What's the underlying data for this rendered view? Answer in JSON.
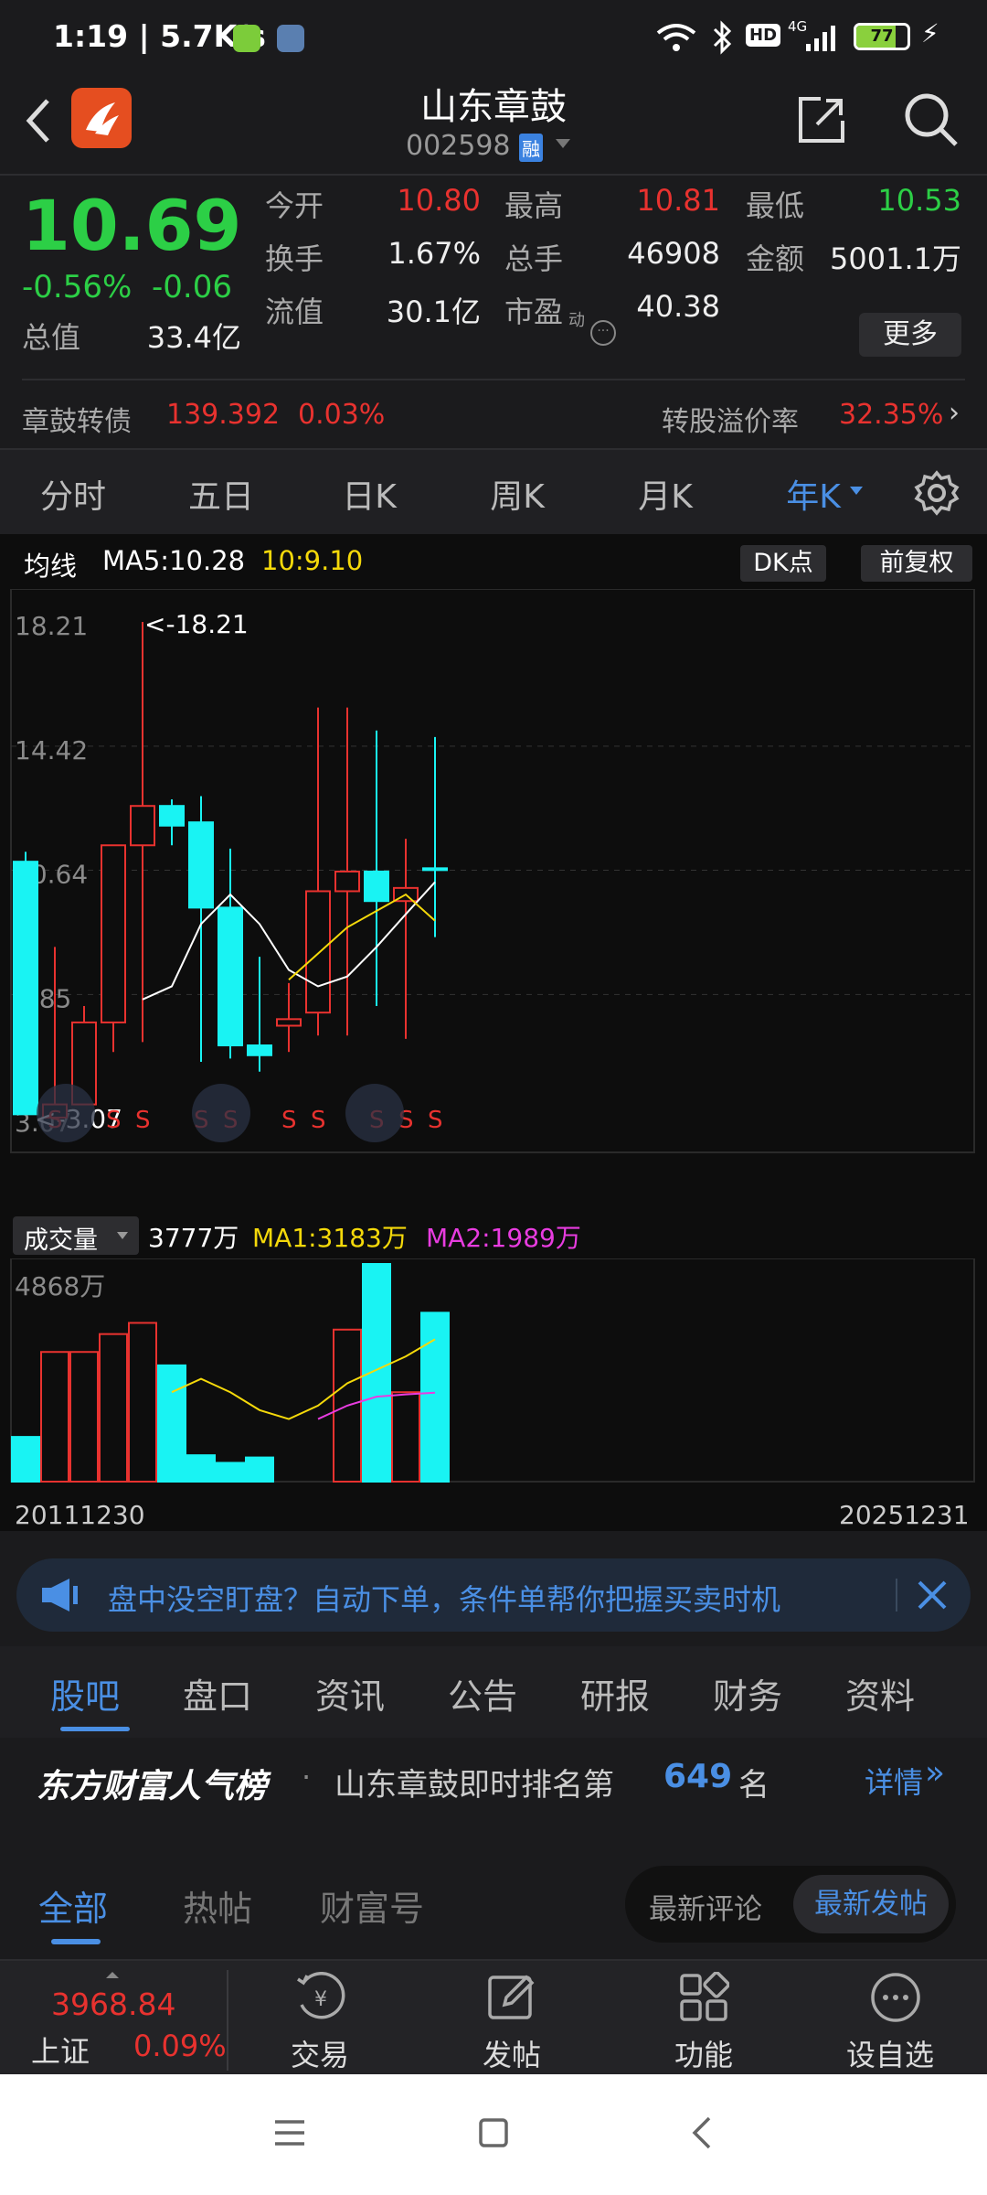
{
  "status_bar": {
    "time": "1:19 | 5.7K/s",
    "battery": "77",
    "net": "4G",
    "hd": "HD"
  },
  "header": {
    "title": "山东章鼓",
    "code": "002598",
    "rong": "融"
  },
  "quote": {
    "price": "10.69",
    "pct": "-0.56%",
    "change": "-0.06",
    "fields": [
      {
        "label": "今开",
        "value": "10.80",
        "color": "#e8322f"
      },
      {
        "label": "最高",
        "value": "10.81",
        "color": "#e8322f"
      },
      {
        "label": "最低",
        "value": "10.53",
        "color": "#2ccf46"
      },
      {
        "label": "换手",
        "value": "1.67%",
        "color": "#eeeeee"
      },
      {
        "label": "总手",
        "value": "46908",
        "color": "#eeeeee"
      },
      {
        "label": "金额",
        "value": "5001.1万",
        "color": "#eeeeee"
      },
      {
        "label": "总值",
        "value": "33.4亿",
        "color": "#eeeeee"
      },
      {
        "label": "流值",
        "value": "30.1亿",
        "color": "#eeeeee"
      },
      {
        "label": "市盈",
        "value": "40.38",
        "color": "#eeeeee"
      }
    ],
    "pe_sup": "动",
    "more": "更多"
  },
  "bond": {
    "name": "章鼓转债",
    "price": "139.392",
    "pct": "0.03%",
    "premium_label": "转股溢价率",
    "premium": "32.35%"
  },
  "chart_tabs": [
    "分时",
    "五日",
    "日K",
    "周K",
    "月K",
    "年K"
  ],
  "kline": {
    "ma_label": "均线",
    "ma5": "MA5:10.28",
    "ma10": "10:9.10",
    "dk": "DK点",
    "adjust": "前复权",
    "axis": [
      "18.21",
      "14.42",
      "10.64",
      "6.85",
      "3.07"
    ],
    "high_label": "<-18.21",
    "low_label": "<-3.07",
    "s_mark": "S"
  },
  "volume": {
    "selector": "成交量",
    "total": "3777万",
    "ma1": "MA1:3183万",
    "ma2": "MA2:1989万",
    "top": "4868万",
    "start": "20111230",
    "end": "20251231"
  },
  "chart_data": {
    "type": "candlestick",
    "x": [
      "2011",
      "2012",
      "2013",
      "2014",
      "2015",
      "2016",
      "2017",
      "2018",
      "2019",
      "2020",
      "2021",
      "2022",
      "2023",
      "2024",
      "2025"
    ],
    "open": [
      10.9,
      3.1,
      3.5,
      6.0,
      11.4,
      12.6,
      12.1,
      9.5,
      5.3,
      5.9,
      6.3,
      10.0,
      10.6,
      9.7,
      10.7
    ],
    "high": [
      11.2,
      8.3,
      6.5,
      9.3,
      18.21,
      12.8,
      12.9,
      11.3,
      8.0,
      7.2,
      15.6,
      15.6,
      14.9,
      11.6,
      14.7
    ],
    "low": [
      3.6,
      3.07,
      3.5,
      5.1,
      5.4,
      11.4,
      4.8,
      4.9,
      4.5,
      5.1,
      5.6,
      5.6,
      6.5,
      5.5,
      8.6
    ],
    "close": [
      3.2,
      3.5,
      6.0,
      11.4,
      12.6,
      12.0,
      9.5,
      5.3,
      5.0,
      6.1,
      10.0,
      10.6,
      9.7,
      10.1,
      10.69
    ],
    "ma5": [
      null,
      null,
      null,
      null,
      6.7,
      7.1,
      9.0,
      9.9,
      9.0,
      7.6,
      7.1,
      7.4,
      8.3,
      9.3,
      10.28
    ],
    "ma10": [
      null,
      null,
      null,
      null,
      null,
      null,
      null,
      null,
      null,
      7.3,
      8.1,
      8.9,
      9.4,
      9.9,
      9.1
    ],
    "volume_wan": [
      1000,
      2900,
      2900,
      3300,
      3550,
      2600,
      590,
      420,
      540,
      null,
      null,
      3400,
      4868,
      2000,
      3777
    ],
    "vol_ma1": [
      null,
      null,
      null,
      null,
      null,
      2000,
      2300,
      2000,
      1600,
      1400,
      1700,
      2200,
      2500,
      2800,
      3183
    ],
    "vol_ma2": [
      null,
      null,
      null,
      null,
      null,
      null,
      null,
      null,
      null,
      null,
      1400,
      1700,
      1900,
      1950,
      1989
    ]
  },
  "banner": {
    "text": "盘中没空盯盘？自动下单，条件单帮你把握买卖时机"
  },
  "section_tabs": [
    "股吧",
    "盘口",
    "资讯",
    "公告",
    "研报",
    "财务",
    "资料"
  ],
  "rank": {
    "logo": "东方财富人气榜",
    "text": "山东章鼓即时排名第",
    "rank": "649",
    "suffix": "名",
    "detail": "详情"
  },
  "post_tabs": {
    "items": [
      "全部",
      "热帖",
      "财富号"
    ],
    "toggle": [
      "最新评论",
      "最新发帖"
    ]
  },
  "bottom": {
    "index_value": "3968.84",
    "index_name": "上证",
    "index_pct": "0.09%",
    "items": [
      "交易",
      "发帖",
      "功能",
      "设自选"
    ]
  }
}
